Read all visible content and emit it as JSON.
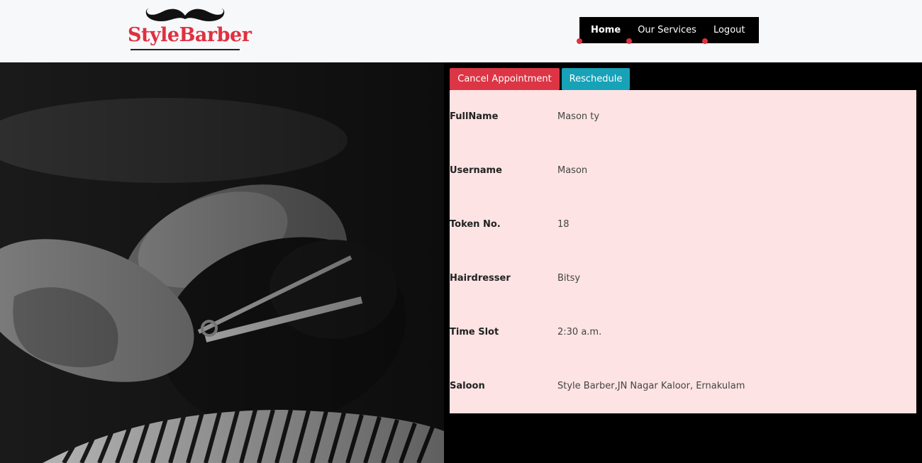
{
  "header": {
    "logo_text": "StyleBarber"
  },
  "nav": {
    "items": [
      {
        "label": "Home",
        "active": true
      },
      {
        "label": "Our Services",
        "active": false
      },
      {
        "label": "Logout",
        "active": false
      }
    ]
  },
  "actions": {
    "cancel_label": "Cancel Appointment",
    "reschedule_label": "Reschedule"
  },
  "appointment": {
    "rows": [
      {
        "label": "FullName",
        "value": "Mason ty"
      },
      {
        "label": "Username",
        "value": "Mason"
      },
      {
        "label": "Token No.",
        "value": "18"
      },
      {
        "label": "Hairdresser",
        "value": "Bitsy"
      },
      {
        "label": "Time Slot",
        "value": "2:30 a.m."
      },
      {
        "label": "Saloon",
        "value": "Style Barber,JN Nagar Kaloor, Ernakulam"
      }
    ]
  },
  "colors": {
    "brand_red": "#e0303f",
    "cancel": "#dc3545",
    "reschedule": "#17a2b8",
    "details_bg": "#fde3e3"
  }
}
